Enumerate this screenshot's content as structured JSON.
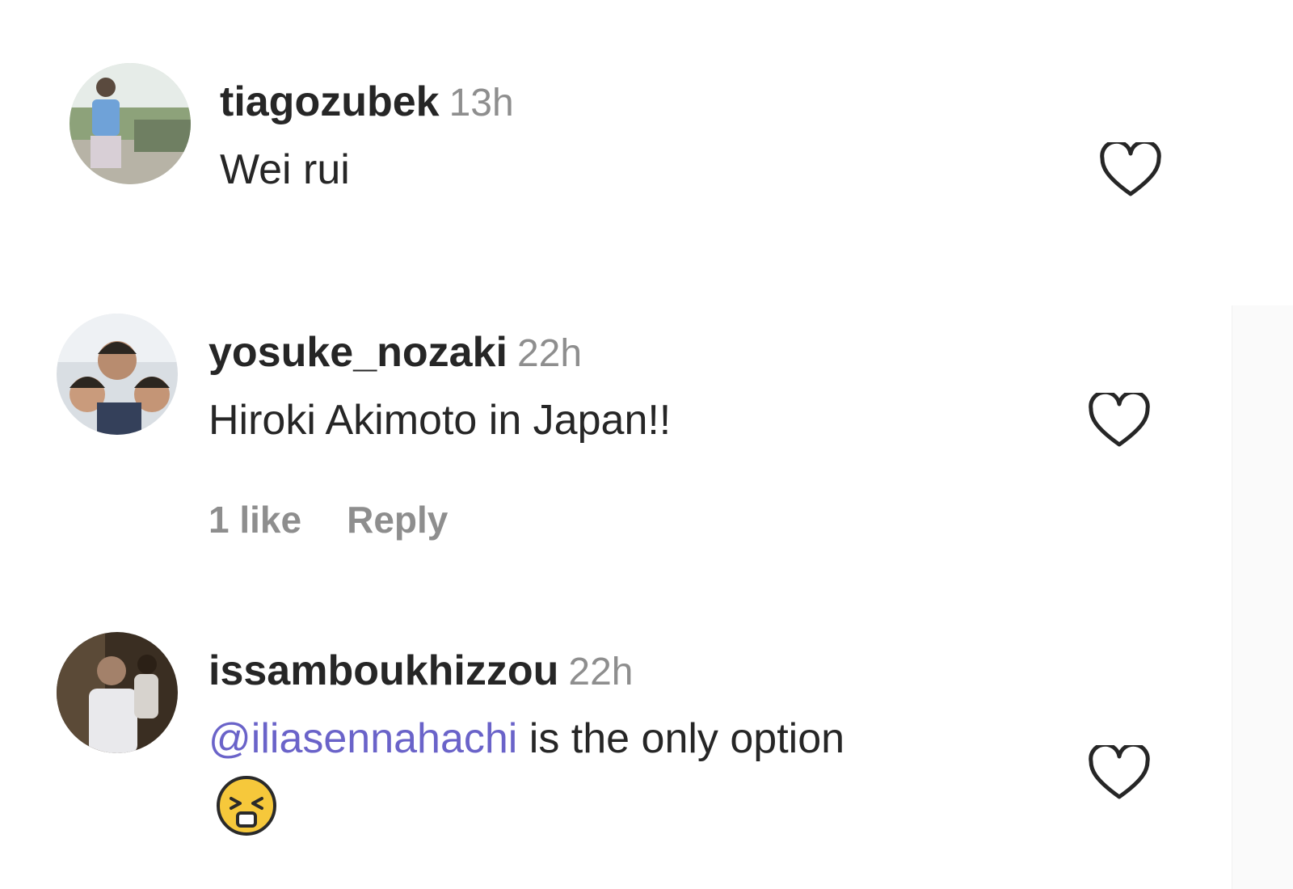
{
  "comments": [
    {
      "username": "tiagozubek",
      "time": "13h",
      "text": "Wei rui",
      "like_icon": "heart-outline-icon"
    },
    {
      "username": "yosuke_nozaki",
      "time": "22h",
      "text": "Hiroki Akimoto in Japan!!",
      "likes_label": "1 like",
      "reply_label": "Reply",
      "like_icon": "heart-outline-icon"
    },
    {
      "username": "issamboukhizzou",
      "time": "22h",
      "mention": "@iliasennahachi",
      "text": " is the only option",
      "emoji": "scrunched-face-emoji",
      "like_icon": "heart-outline-icon"
    }
  ],
  "colors": {
    "username": "#262626",
    "meta": "#8e8e8e",
    "mention": "#6a63c9",
    "heart_stroke": "#262626"
  }
}
